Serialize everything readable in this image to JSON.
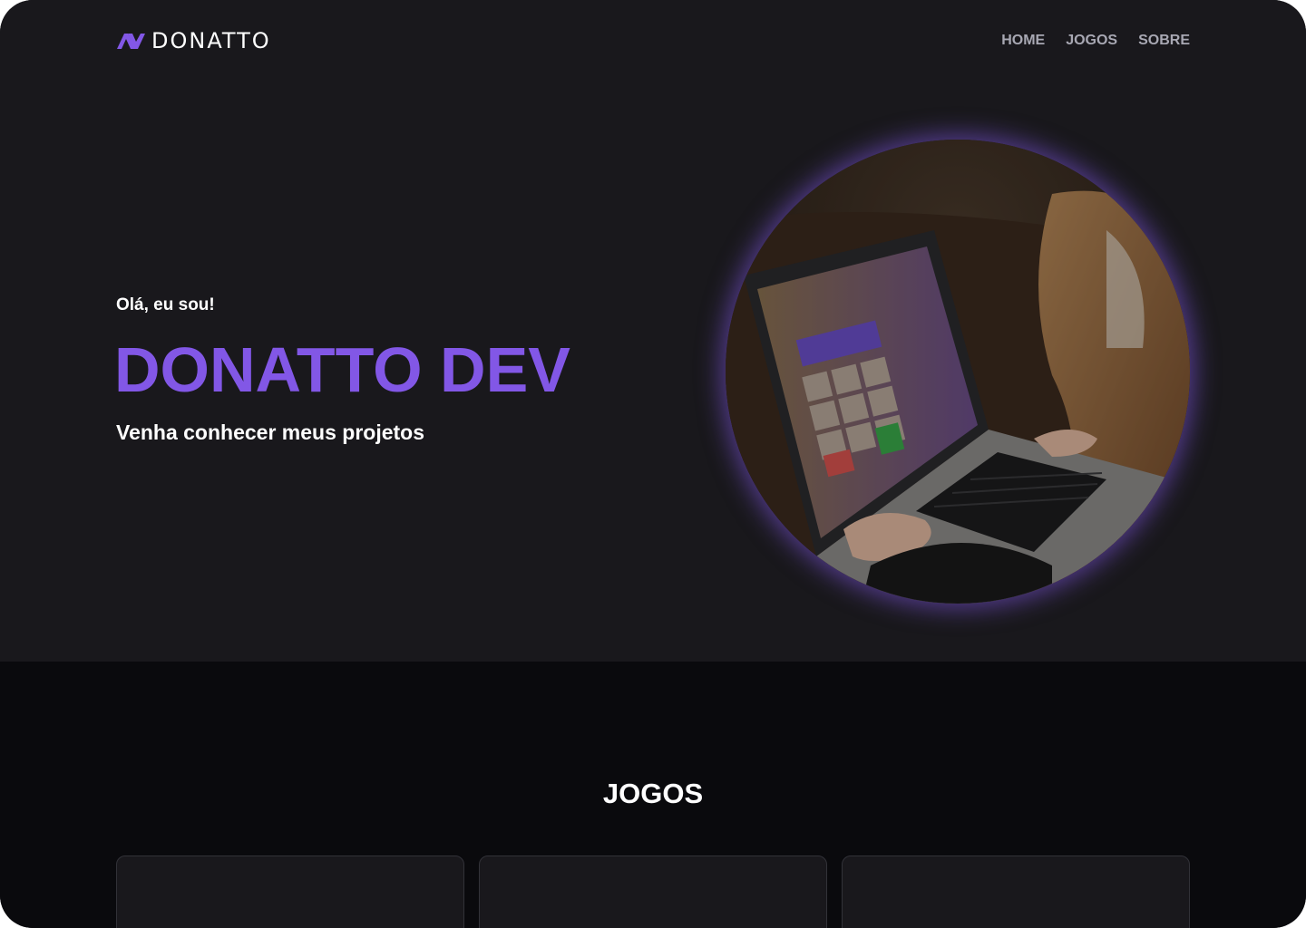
{
  "brand": {
    "name": "DONATTO",
    "accent_color": "#8257e6"
  },
  "nav": {
    "items": [
      {
        "label": "HOME"
      },
      {
        "label": "JOGOS"
      },
      {
        "label": "SOBRE"
      }
    ]
  },
  "hero": {
    "greeting": "Olá, eu sou!",
    "title": "DONATTO DEV",
    "subtitle": "Venha conhecer meus projetos",
    "image": {
      "icon": "hero-photo-laptop"
    }
  },
  "games": {
    "title": "JOGOS",
    "cards": [
      {},
      {},
      {}
    ]
  }
}
